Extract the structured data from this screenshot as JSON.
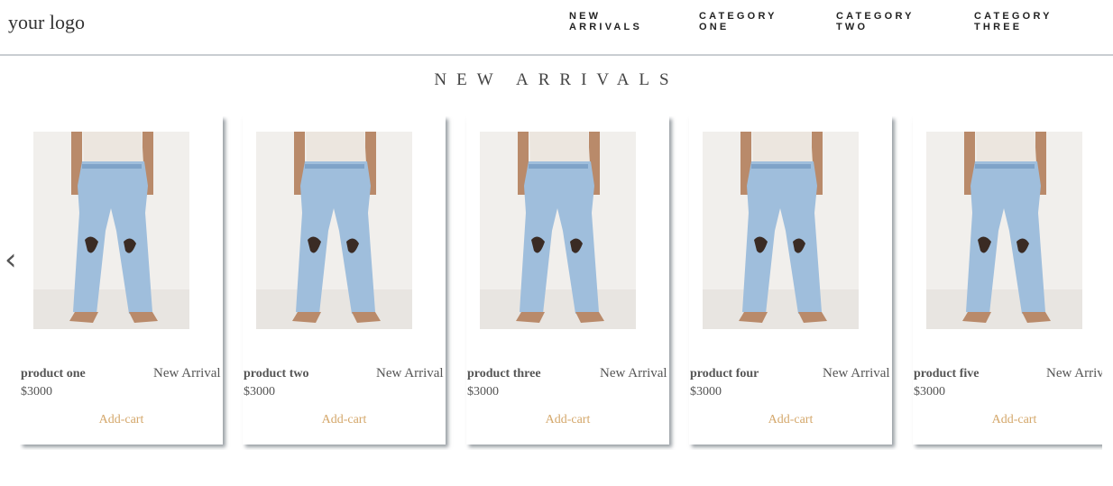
{
  "header": {
    "logo": "your logo",
    "nav": [
      {
        "line1": "NEW",
        "line2": "ARRIVALS"
      },
      {
        "line1": "CATEGORY",
        "line2": "ONE"
      },
      {
        "line1": "CATEGORY",
        "line2": "TWO"
      },
      {
        "line1": "CATEGORY",
        "line2": "THREE"
      }
    ]
  },
  "section": {
    "title": "NEW ARRIVALS"
  },
  "carousel": {
    "prev_icon": "‹",
    "next_icon": "›",
    "products": [
      {
        "name": "product one",
        "badge": "New Arrival",
        "price": "$3000",
        "action": "Add-cart"
      },
      {
        "name": "product two",
        "badge": "New Arrival",
        "price": "$3000",
        "action": "Add-cart"
      },
      {
        "name": "product three",
        "badge": "New Arrival",
        "price": "$3000",
        "action": "Add-cart"
      },
      {
        "name": "product four",
        "badge": "New Arrival",
        "price": "$3000",
        "action": "Add-cart"
      },
      {
        "name": "product five",
        "badge": "New Arrival",
        "price": "$3000",
        "action": "Add-cart"
      }
    ]
  },
  "colors": {
    "accent": "#d4a76a",
    "denim": "#9fbedc",
    "shirt": "#ece6df",
    "skin": "#b98a6a"
  }
}
